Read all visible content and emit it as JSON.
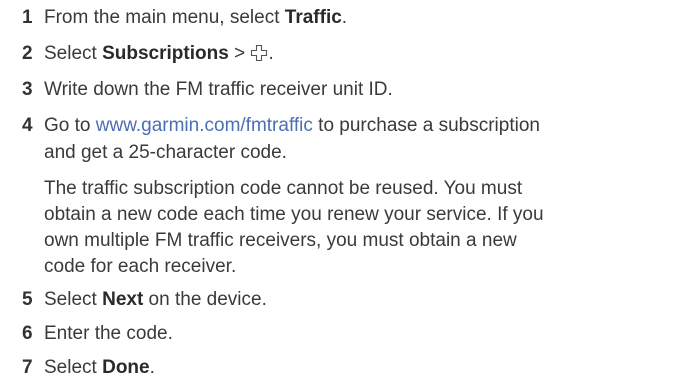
{
  "steps": [
    {
      "number": "1",
      "text_before": "From the main menu, select ",
      "bold": "Traffic",
      "text_after": "."
    },
    {
      "number": "2",
      "text_before": "Select ",
      "bold": "Subscriptions",
      "text_after": " > ",
      "icon": "plus-icon",
      "text_end": "."
    },
    {
      "number": "3",
      "text": "Write down the FM traffic receiver unit ID."
    },
    {
      "number": "4",
      "text_before": "Go to ",
      "link": "www.garmin.com/fmtraffic",
      "text_after_line1": " to purchase a subscription",
      "text_line2": "and get a 25-character code.",
      "note_lines": [
        "The traffic subscription code cannot be reused. You must",
        "obtain a new code each time you renew your service. If you",
        "own multiple FM traffic receivers, you must obtain a new",
        "code for each receiver."
      ]
    },
    {
      "number": "5",
      "text_before": "Select ",
      "bold": "Next",
      "text_after": " on the device."
    },
    {
      "number": "6",
      "text": "Enter the code."
    },
    {
      "number": "7",
      "text_before": "Select ",
      "bold": "Done",
      "text_after": "."
    }
  ],
  "colors": {
    "text": "#3a3a3a",
    "link": "#4a6fb3",
    "background": "#ffffff"
  }
}
